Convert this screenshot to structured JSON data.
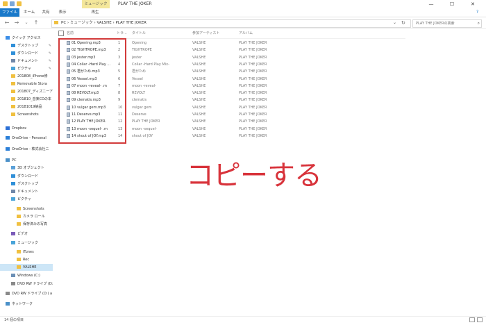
{
  "window": {
    "tool_tab": "ミュージック ツール",
    "title": "PLAY THE JOKER",
    "minimize": "—",
    "maximize": "☐",
    "close": "✕"
  },
  "ribbon": {
    "tabs": [
      "ファイル",
      "ホーム",
      "共有",
      "表示",
      "再生"
    ]
  },
  "nav": {
    "back": "←",
    "forward": "→",
    "recent": "⌄",
    "up": "↑"
  },
  "address": {
    "breadcrumb": "PC  ›  ミュージック  ›  VALSHE  ›  PLAY THE JOKER",
    "refresh": "↻",
    "dropdown": "⌄"
  },
  "search": {
    "placeholder": "PLAY THE JOKERの検索"
  },
  "sidebar": {
    "items": [
      {
        "label": "クイック アクセス",
        "color": "#3b8ee8",
        "pinned": false
      },
      {
        "label": "デスクトップ",
        "color": "#2f8fd8",
        "pinned": true
      },
      {
        "label": "ダウンロード",
        "color": "#2f8fd8",
        "pinned": true
      },
      {
        "label": "ドキュメント",
        "color": "#6f87a8",
        "pinned": true
      },
      {
        "label": "ピクチャ",
        "color": "#4aa4d9",
        "pinned": true
      },
      {
        "label": "201808_iPhone修",
        "color": "#f0c040",
        "pinned": false
      },
      {
        "label": "Removable Stora",
        "color": "#f0c040",
        "pinned": false
      },
      {
        "label": "201807_ディズニーア",
        "color": "#f0c040",
        "pinned": false
      },
      {
        "label": "201810_音楽CDの本",
        "color": "#f0c040",
        "pinned": false
      },
      {
        "label": "20181019納品",
        "color": "#f0c040",
        "pinned": false
      },
      {
        "label": "Screenshots",
        "color": "#f0c040",
        "pinned": false
      },
      {
        "label": "Dropbox",
        "color": "#2b6fd6",
        "pinned": false
      },
      {
        "label": "OneDrive - Personal",
        "color": "#2b7fd8",
        "pinned": false
      },
      {
        "label": "OneDrive - 株式会社ニ",
        "color": "#2b7fd8",
        "pinned": false
      },
      {
        "label": "PC",
        "color": "#4a90c8",
        "pinned": false
      },
      {
        "label": "3D オブジェクト",
        "color": "#5aa0d8",
        "pinned": false
      },
      {
        "label": "ダウンロード",
        "color": "#2f8fd8",
        "pinned": false
      },
      {
        "label": "デスクトップ",
        "color": "#2f8fd8",
        "pinned": false
      },
      {
        "label": "ドキュメント",
        "color": "#6f87a8",
        "pinned": false
      },
      {
        "label": "ピクチャ",
        "color": "#4aa4d9",
        "pinned": false
      },
      {
        "label": "Screenshots",
        "color": "#f0c040",
        "pinned": false
      },
      {
        "label": "カメラ ロール",
        "color": "#f0c040",
        "pinned": false
      },
      {
        "label": "保存済みの写真",
        "color": "#f0c040",
        "pinned": false
      },
      {
        "label": "ビデオ",
        "color": "#7b5bb8",
        "pinned": false
      },
      {
        "label": "ミュージック",
        "color": "#4aa4d9",
        "pinned": false
      },
      {
        "label": "iTunes",
        "color": "#f0c040",
        "pinned": false
      },
      {
        "label": "Rec",
        "color": "#f0c040",
        "pinned": false
      },
      {
        "label": "VALSHE",
        "color": "#f0c040",
        "pinned": false
      },
      {
        "label": "Windows (C:)",
        "color": "#6b8fb5",
        "pinned": false
      },
      {
        "label": "DVD RW ドライブ (D:)",
        "color": "#8a8a8a",
        "pinned": false
      },
      {
        "label": "DVD RW ドライブ (D:) a",
        "color": "#8a8a8a",
        "pinned": false
      },
      {
        "label": "ネットワーク",
        "color": "#4a90c8",
        "pinned": false
      }
    ]
  },
  "columns": [
    "名前",
    "トラ...",
    "タイトル",
    "参加アーティスト",
    "アルバム"
  ],
  "files": [
    {
      "name": "01 Opening.mp3",
      "track": "1",
      "title": "Opening",
      "artist": "VALSHE",
      "album": "PLAY THE JOKER"
    },
    {
      "name": "02 TIGHTROPE.mp3",
      "track": "2",
      "title": "TIGHTROPE",
      "artist": "VALSHE",
      "album": "PLAY THE JOKER"
    },
    {
      "name": "03 jester.mp3",
      "track": "3",
      "title": "jester",
      "artist": "VALSHE",
      "album": "PLAY THE JOKER"
    },
    {
      "name": "04 Collar -Hard Play ...",
      "track": "4",
      "title": "Collar -Hard Play Mix-",
      "artist": "VALSHE",
      "album": "PLAY THE JOKER"
    },
    {
      "name": "05 君がため.mp3",
      "track": "5",
      "title": "君がため",
      "artist": "VALSHE",
      "album": "PLAY THE JOKER"
    },
    {
      "name": "06 Vessel.mp3",
      "track": "6",
      "title": "Vessel",
      "artist": "VALSHE",
      "album": "PLAY THE JOKER"
    },
    {
      "name": "07 moon -reveal- .m",
      "track": "7",
      "title": "moon -reveal-",
      "artist": "VALSHE",
      "album": "PLAY THE JOKER"
    },
    {
      "name": "08 REVOLT.mp3",
      "track": "8",
      "title": "REVOLT",
      "artist": "VALSHE",
      "album": "PLAY THE JOKER"
    },
    {
      "name": "09 clematis.mp3",
      "track": "9",
      "title": "clematis",
      "artist": "VALSHE",
      "album": "PLAY THE JOKER"
    },
    {
      "name": "10 vulgar gem.mp3",
      "track": "10",
      "title": "vulgar gem",
      "artist": "VALSHE",
      "album": "PLAY THE JOKER"
    },
    {
      "name": "11 Deserve.mp3",
      "track": "11",
      "title": "Deserve",
      "artist": "VALSHE",
      "album": "PLAY THE JOKER"
    },
    {
      "name": "12 PLAY THE JOKER.",
      "track": "12",
      "title": "PLAY THE JOKER",
      "artist": "VALSHE",
      "album": "PLAY THE JOKER"
    },
    {
      "name": "13 moon -sequel- .m",
      "track": "13",
      "title": "moon -sequel-",
      "artist": "VALSHE",
      "album": "PLAY THE JOKER"
    },
    {
      "name": "14 shout of JOY.mp3",
      "track": "14",
      "title": "shout of JOY",
      "artist": "VALSHE",
      "album": "PLAY THE JOKER"
    }
  ],
  "annotation": {
    "caption": "コピーする",
    "color": "#d8333b"
  },
  "status": {
    "text": "14 個の項目"
  }
}
